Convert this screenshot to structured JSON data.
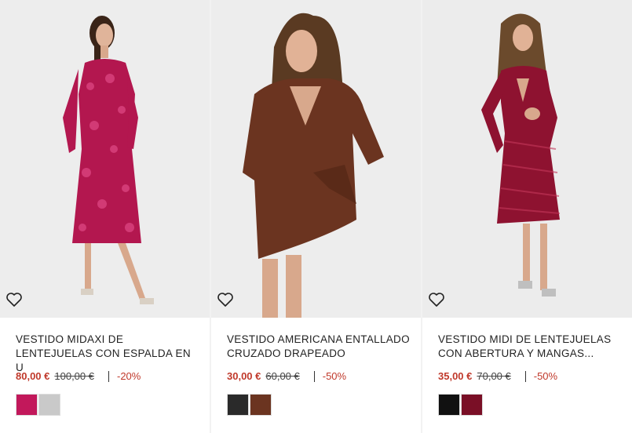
{
  "products": [
    {
      "title": "VESTIDO MIDAXI DE LENTEJUELAS CON ESPALDA EN U",
      "price_now": "80,00 €",
      "price_old": "100,00 €",
      "discount": "-20%",
      "dress_color": "#b3174f",
      "swatches": [
        {
          "name": "fuchsia-sequin",
          "color": "#c2185b"
        },
        {
          "name": "silver-sequin",
          "color": "#c9c9c9"
        }
      ]
    },
    {
      "title": "VESTIDO AMERICANA ENTALLADO CRUZADO DRAPEADO",
      "price_now": "30,00 €",
      "price_old": "60,00 €",
      "discount": "-50%",
      "dress_color": "#6b3420",
      "swatches": [
        {
          "name": "black",
          "color": "#2a2a2a"
        },
        {
          "name": "chocolate",
          "color": "#6b3420"
        }
      ]
    },
    {
      "title": "VESTIDO MIDI DE LENTEJUELAS CON ABERTURA Y MANGAS...",
      "price_now": "35,00 €",
      "price_old": "70,00 €",
      "discount": "-50%",
      "dress_color": "#8e1230",
      "swatches": [
        {
          "name": "black-sequin",
          "color": "#111111"
        },
        {
          "name": "burgundy-sequin",
          "color": "#7a0f26"
        }
      ]
    }
  ]
}
